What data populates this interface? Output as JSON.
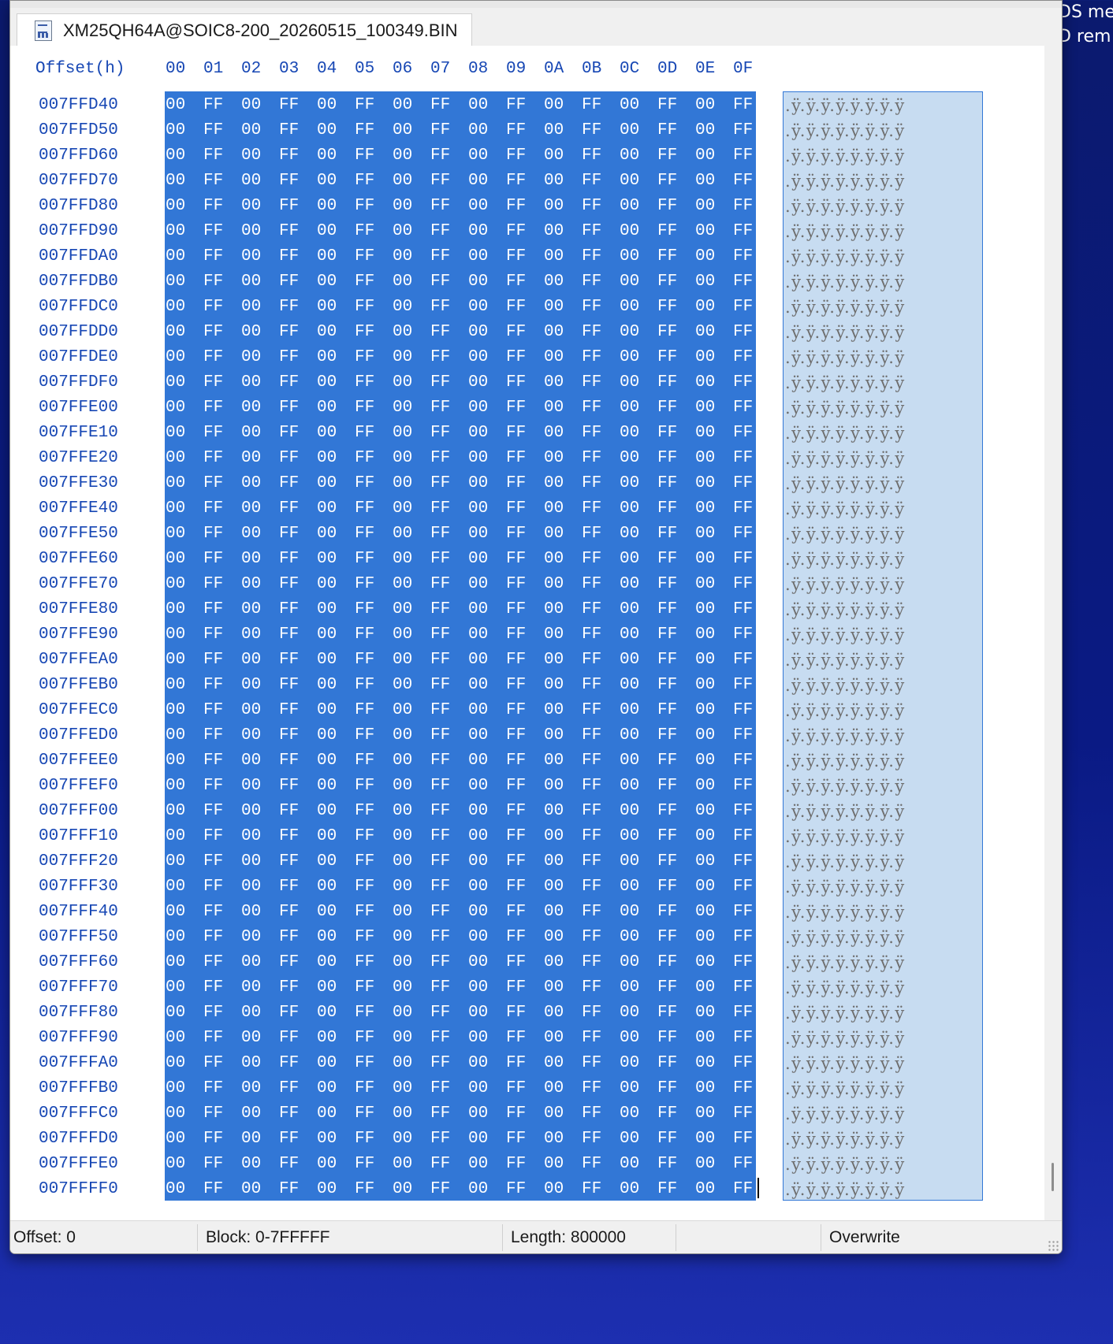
{
  "desktop": {
    "text_line1": "DS me",
    "text_line2": "D rem"
  },
  "tab": {
    "title": "XM25QH64A@SOIC8-200_20260515_100349.BIN",
    "icon": "binary-file-icon"
  },
  "header": {
    "offset_label": "Offset(h)",
    "columns": [
      "00",
      "01",
      "02",
      "03",
      "04",
      "05",
      "06",
      "07",
      "08",
      "09",
      "0A",
      "0B",
      "0C",
      "0D",
      "0E",
      "0F"
    ]
  },
  "rows": [
    {
      "offset": "007FFD40"
    },
    {
      "offset": "007FFD50"
    },
    {
      "offset": "007FFD60"
    },
    {
      "offset": "007FFD70"
    },
    {
      "offset": "007FFD80"
    },
    {
      "offset": "007FFD90"
    },
    {
      "offset": "007FFDA0"
    },
    {
      "offset": "007FFDB0"
    },
    {
      "offset": "007FFDC0"
    },
    {
      "offset": "007FFDD0"
    },
    {
      "offset": "007FFDE0"
    },
    {
      "offset": "007FFDF0"
    },
    {
      "offset": "007FFE00"
    },
    {
      "offset": "007FFE10"
    },
    {
      "offset": "007FFE20"
    },
    {
      "offset": "007FFE30"
    },
    {
      "offset": "007FFE40"
    },
    {
      "offset": "007FFE50"
    },
    {
      "offset": "007FFE60"
    },
    {
      "offset": "007FFE70"
    },
    {
      "offset": "007FFE80"
    },
    {
      "offset": "007FFE90"
    },
    {
      "offset": "007FFEA0"
    },
    {
      "offset": "007FFEB0"
    },
    {
      "offset": "007FFEC0"
    },
    {
      "offset": "007FFED0"
    },
    {
      "offset": "007FFEE0"
    },
    {
      "offset": "007FFEF0"
    },
    {
      "offset": "007FFF00"
    },
    {
      "offset": "007FFF10"
    },
    {
      "offset": "007FFF20"
    },
    {
      "offset": "007FFF30"
    },
    {
      "offset": "007FFF40"
    },
    {
      "offset": "007FFF50"
    },
    {
      "offset": "007FFF60"
    },
    {
      "offset": "007FFF70"
    },
    {
      "offset": "007FFF80"
    },
    {
      "offset": "007FFF90"
    },
    {
      "offset": "007FFFA0"
    },
    {
      "offset": "007FFFB0"
    },
    {
      "offset": "007FFFC0"
    },
    {
      "offset": "007FFFD0"
    },
    {
      "offset": "007FFFE0"
    },
    {
      "offset": "007FFFF0"
    }
  ],
  "row_bytes": [
    "00",
    "FF",
    "00",
    "FF",
    "00",
    "FF",
    "00",
    "FF",
    "00",
    "FF",
    "00",
    "FF",
    "00",
    "FF",
    "00",
    "FF"
  ],
  "row_ascii": ".ÿ.ÿ.ÿ.ÿ.ÿ.ÿ.ÿ.ÿ",
  "status": {
    "offset": "Offset: 0",
    "block": "Block: 0-7FFFFF",
    "length": "Length: 800000",
    "mode": "Overwrite"
  },
  "colors": {
    "selection": "#3277d6",
    "ascii_selection": "#c7dcf1",
    "offset_text": "#1747b4"
  }
}
